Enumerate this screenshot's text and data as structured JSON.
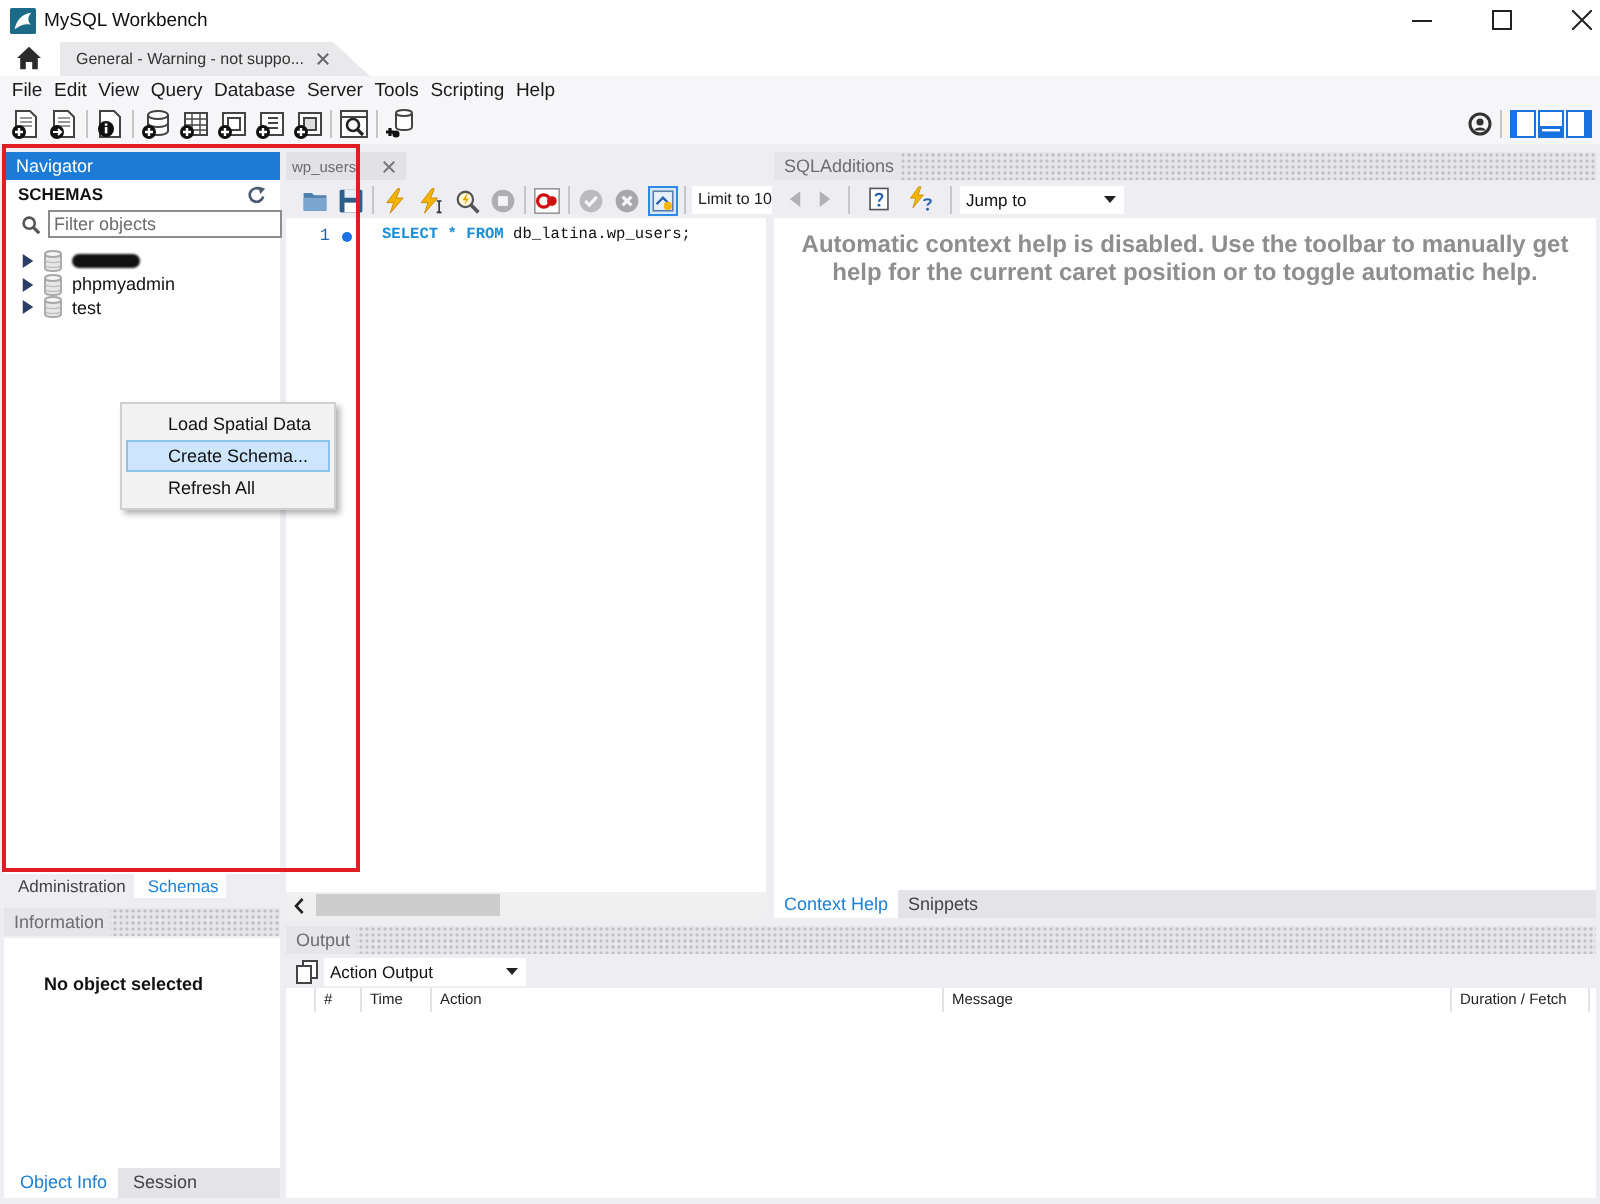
{
  "window": {
    "title": "MySQL Workbench"
  },
  "connection_tabs": [
    {
      "label": "General - Warning - not suppo...",
      "selected": true
    }
  ],
  "menu": [
    "File",
    "Edit",
    "View",
    "Query",
    "Database",
    "Server",
    "Tools",
    "Scripting",
    "Help"
  ],
  "layout_toggles": [
    {
      "kind": "left",
      "on": true
    },
    {
      "kind": "bottom",
      "on": true
    },
    {
      "kind": "right",
      "on": true
    }
  ],
  "navigator": {
    "title": "Navigator",
    "section": "SCHEMAS",
    "filter": {
      "placeholder": "Filter objects"
    },
    "schemas": [
      {
        "kind": "redacted",
        "expanded": false
      },
      {
        "kind": "schema",
        "label": "phpmyadmin",
        "expanded": false
      },
      {
        "kind": "schema",
        "label": "test",
        "expanded": false
      }
    ],
    "tabs": [
      {
        "label": "Administration",
        "selected": false
      },
      {
        "label": "Schemas",
        "selected": true
      }
    ]
  },
  "context_menu": {
    "items": [
      {
        "label": "Load Spatial Data",
        "selected": false
      },
      {
        "label": "Create Schema...",
        "selected": true
      },
      {
        "label": "Refresh All",
        "selected": false
      }
    ]
  },
  "information": {
    "title": "Information",
    "message": "No object selected",
    "tabs": [
      {
        "label": "Object Info",
        "selected": true
      },
      {
        "label": "Session",
        "selected": false
      }
    ]
  },
  "editor": {
    "tab": {
      "label": "wp_users"
    },
    "tools": [
      {
        "kind": "open",
        "disabled": false,
        "on": false
      },
      {
        "kind": "save",
        "disabled": false,
        "on": false
      },
      {
        "kind": "execute",
        "disabled": false,
        "on": false
      },
      {
        "kind": "execute_current",
        "disabled": false,
        "on": false
      },
      {
        "kind": "explain",
        "disabled": false,
        "on": false
      },
      {
        "kind": "stop",
        "disabled": true,
        "on": false
      },
      {
        "kind": "error_toggle",
        "disabled": false,
        "on": false
      },
      {
        "kind": "commit",
        "disabled": true,
        "on": false
      },
      {
        "kind": "rollback",
        "disabled": true,
        "on": false
      },
      {
        "kind": "autocommit",
        "disabled": false,
        "on": true
      }
    ],
    "limit": "Limit to 10",
    "lines": [
      {
        "number": "1",
        "tokens": [
          {
            "kind": "keyword",
            "text": "SELECT"
          },
          {
            "kind": "keyword",
            "text": "*"
          },
          {
            "kind": "keyword",
            "text": "FROM"
          },
          {
            "kind": "plain",
            "text": "db_latina.wp_users;"
          }
        ]
      }
    ]
  },
  "sql_additions": {
    "title": "SQLAdditions",
    "nav": [
      {
        "kind": "back",
        "disabled": true
      },
      {
        "kind": "forward",
        "disabled": true
      }
    ],
    "jump_to": "Jump to",
    "help": "Automatic context help is disabled. Use the toolbar to manually get help for the current caret position or to toggle automatic help.",
    "tabs": [
      {
        "label": "Context Help",
        "selected": true
      },
      {
        "label": "Snippets",
        "selected": false
      }
    ]
  },
  "output": {
    "title": "Output",
    "selector": "Action Output",
    "columns": [
      "#",
      "Time",
      "Action",
      "Message",
      "Duration / Fetch"
    ]
  }
}
